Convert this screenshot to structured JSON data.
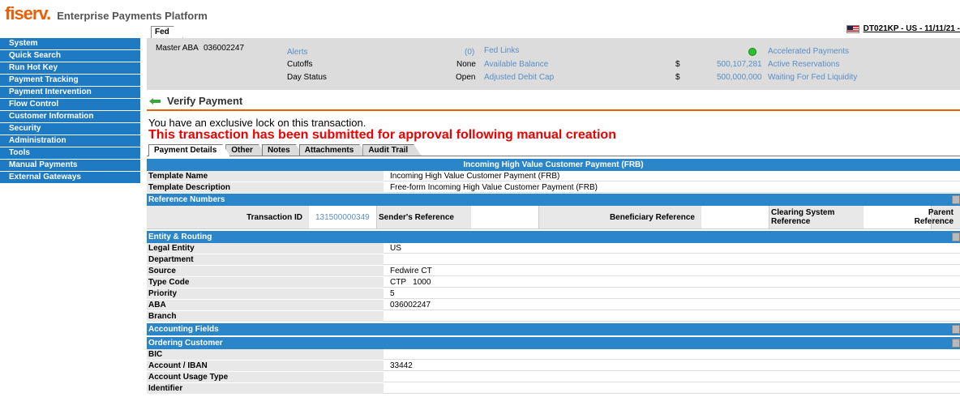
{
  "header": {
    "logo": "fiserv.",
    "app_title": "Enterprise Payments Platform",
    "user_info": "DT021KP - US - 11/11/21 -"
  },
  "sidebar": {
    "items": [
      {
        "label": "System"
      },
      {
        "label": "Quick Search"
      },
      {
        "label": "Run Hot Key"
      },
      {
        "label": "Payment Tracking"
      },
      {
        "label": "Payment Intervention"
      },
      {
        "label": "Flow Control"
      },
      {
        "label": "Customer Information"
      },
      {
        "label": "Security"
      },
      {
        "label": "Administration"
      },
      {
        "label": "Tools"
      },
      {
        "label": "Manual Payments"
      },
      {
        "label": "External Gateways"
      }
    ]
  },
  "fed_panel": {
    "tab_label": "Fed",
    "master_aba_label": "Master ABA",
    "master_aba_value": "036002247",
    "alerts_label": "Alerts",
    "alerts_value": "(0)",
    "cutoffs_label": "Cutoffs",
    "cutoffs_value": "None",
    "day_status_label": "Day Status",
    "day_status_value": "Open",
    "fed_links_label": "Fed Links",
    "available_balance_label": "Available Balance",
    "available_balance_currency": "$",
    "available_balance_value": "500,107,281",
    "adjusted_debit_cap_label": "Adjusted Debit Cap",
    "adjusted_debit_cap_currency": "$",
    "adjusted_debit_cap_value": "500,000,000",
    "accelerated_payments_label": "Accelerated Payments",
    "active_reservations_label": "Active Reservations",
    "waiting_label": "Waiting For Fed Liquidity",
    "status_color": "#2ec02e"
  },
  "page": {
    "title": "Verify Payment",
    "lock_message": "You have an exclusive lock on this transaction.",
    "alert_message": "This transaction has been submitted for approval following manual creation"
  },
  "tabs": [
    {
      "label": "Payment Details"
    },
    {
      "label": "Other"
    },
    {
      "label": "Notes"
    },
    {
      "label": "Attachments"
    },
    {
      "label": "Audit Trail"
    }
  ],
  "details": {
    "header": "Incoming High Value Customer Payment (FRB)",
    "template_name_label": "Template Name",
    "template_name_value": "Incoming High Value Customer Payment (FRB)",
    "template_desc_label": "Template Description",
    "template_desc_value": "Free-form Incoming High Value Customer Payment (FRB)"
  },
  "reference_numbers": {
    "header": "Reference Numbers",
    "transaction_id_label": "Transaction ID",
    "transaction_id_value": "131500000349",
    "senders_ref_label": "Sender's Reference",
    "beneficiary_ref_label": "Beneficiary Reference",
    "clearing_ref_label": "Clearing System Reference",
    "parent_ref_label": "Parent Reference"
  },
  "entity_routing": {
    "header": "Entity & Routing",
    "rows": [
      {
        "label": "Legal Entity",
        "value": "US"
      },
      {
        "label": "Department",
        "value": ""
      },
      {
        "label": "Source",
        "value": "Fedwire CT"
      },
      {
        "label": "Type Code",
        "value": "CTP   1000"
      },
      {
        "label": "Priority",
        "value": "5"
      },
      {
        "label": "ABA",
        "value": "036002247"
      },
      {
        "label": "Branch",
        "value": ""
      }
    ]
  },
  "accounting_fields": {
    "header": "Accounting Fields"
  },
  "ordering_customer": {
    "header": "Ordering Customer",
    "rows": [
      {
        "label": "BIC",
        "value": ""
      },
      {
        "label": "Account / IBAN",
        "value": "33442"
      },
      {
        "label": "Account Usage Type",
        "value": ""
      },
      {
        "label": "Identifier",
        "value": ""
      }
    ]
  },
  "colors": {
    "brand": "#e8600a",
    "nav": "#1f7ac4",
    "section": "#2a86c8",
    "alert": "#e00000",
    "link": "#5a8fc8"
  }
}
